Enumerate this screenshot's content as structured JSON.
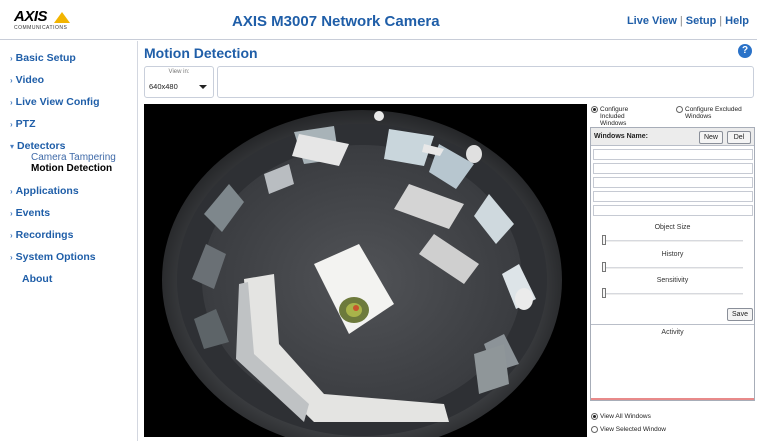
{
  "header": {
    "logo_text": "AXIS",
    "logo_subtext": "COMMUNICATIONS",
    "app_title": "AXIS M3007 Network Camera",
    "nav": [
      "Live View",
      "Setup",
      "Help"
    ]
  },
  "sidebar": {
    "items": [
      {
        "label": "Basic Setup",
        "arrow": "›"
      },
      {
        "label": "Video",
        "arrow": "›"
      },
      {
        "label": "Live View Config",
        "arrow": "›"
      },
      {
        "label": "PTZ",
        "arrow": "›"
      },
      {
        "label": "Detectors",
        "arrow": "▾"
      },
      {
        "label": "Applications",
        "arrow": "›"
      },
      {
        "label": "Events",
        "arrow": "›"
      },
      {
        "label": "Recordings",
        "arrow": "›"
      },
      {
        "label": "System Options",
        "arrow": "›"
      },
      {
        "label": "About",
        "arrow": ""
      }
    ],
    "subitems": [
      "Camera Tampering",
      "Motion Detection"
    ]
  },
  "main": {
    "page_title": "Motion Detection",
    "help_label": "?",
    "view_in_label": "View in:",
    "resolution": "640x480"
  },
  "panel": {
    "radio_included": "Configure Included Windows",
    "radio_excluded": "Configure Excluded Windows",
    "windows_name_label": "Windows Name:",
    "new_label": "New",
    "del_label": "Del",
    "sliders": [
      {
        "label": "Object Size",
        "value": 0
      },
      {
        "label": "History",
        "value": 0
      },
      {
        "label": "Sensitivity",
        "value": 0
      }
    ],
    "save_label": "Save",
    "activity_label": "Activity",
    "view_all_label": "View All Windows",
    "view_selected_label": "View Selected Window"
  },
  "colors": {
    "link": "#1f5ea8",
    "logo_accent": "#f2b400",
    "activity_line": "#e88a8a"
  }
}
